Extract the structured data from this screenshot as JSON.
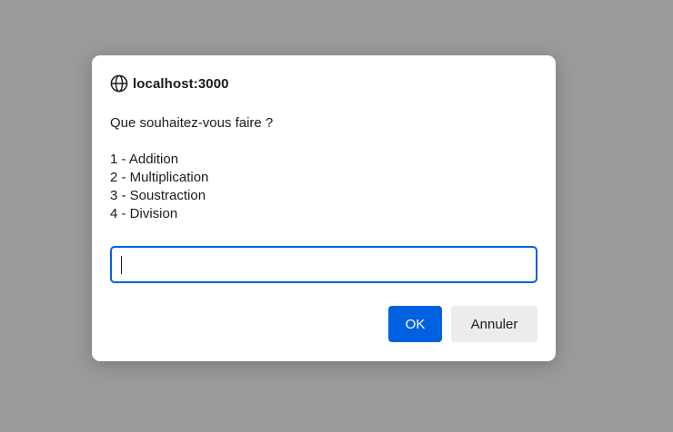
{
  "dialog": {
    "origin": "localhost:3000",
    "origin_icon": "globe-icon",
    "message_lines": [
      "Que souhaitez-vous faire ?",
      "",
      "1 - Addition",
      "2 - Multiplication",
      "3 - Soustraction",
      "4 - Division"
    ],
    "input_value": "",
    "ok_label": "OK",
    "cancel_label": "Annuler"
  },
  "colors": {
    "backdrop": "#9a9a9c",
    "accent": "#0061e0",
    "cancel_bg": "#ececee"
  }
}
